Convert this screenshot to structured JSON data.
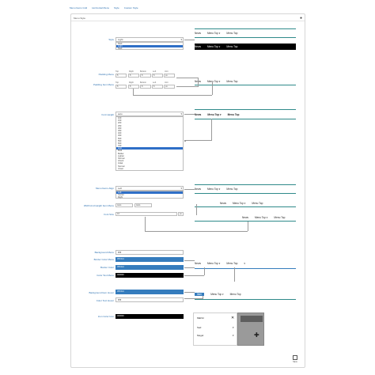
{
  "tabs": [
    "Menu Items Grid",
    "Horizontal Menu",
    "Style",
    "Custom Style"
  ],
  "panel": {
    "title": "Menu Style"
  },
  "fields": {
    "style": {
      "label": "Style",
      "value": "Light",
      "options": [
        "Dark",
        "Light",
        "Dark"
      ]
    },
    "padding_menu": {
      "label": "Padding Menu",
      "caps": [
        "Top",
        "Right",
        "Bottom",
        "Left",
        "Unit"
      ],
      "values": [
        "5",
        "5",
        "5",
        "5",
        "px"
      ]
    },
    "padding_item": {
      "label": "Padding Item Menu",
      "caps": [
        "Top",
        "Right",
        "Bottom",
        "Left",
        "Unit"
      ],
      "values": [
        "5",
        "5",
        "5",
        "5",
        "px"
      ]
    },
    "font_height": {
      "label": "Font Height",
      "value": "auto",
      "options": [
        "100",
        "150",
        "200",
        "250",
        "300",
        "350",
        "400",
        "450",
        "500",
        "550",
        "600",
        "700",
        "auto",
        "Bold",
        "Bolder",
        "Lighter",
        "Normal",
        "Inherit",
        "Initial",
        "Normal",
        "Unset"
      ],
      "highlight": 12
    },
    "align": {
      "label": "Menu Items Align",
      "value": "Left",
      "options": [
        "Left",
        "Center",
        "Right"
      ]
    },
    "width": {
      "label": "Width And Height Item Menu",
      "v1": "Auto",
      "v2": "Auto"
    },
    "font_size": {
      "label": "Font Size",
      "value": "16",
      "unit": "px"
    },
    "bg_menu": {
      "label": "Background Menu",
      "value": "ffffff"
    },
    "border_menu": {
      "label": "Border Color Menu",
      "value": "357cbd"
    },
    "border_color": {
      "label": "Border Color",
      "value": "357cbd"
    },
    "color_text": {
      "label": "Color Text Menu",
      "value": "000000"
    },
    "bg_hover": {
      "label": "Background Item Hover",
      "value": "357cbd"
    },
    "text_hover": {
      "label": "Color Text Hover",
      "value": "ffffff"
    },
    "icon_color": {
      "label": "Icon Color Icon",
      "value": "000000"
    }
  },
  "colors": {
    "blue": "#357cbd",
    "white": "#ffffff",
    "black": "#000000"
  },
  "previews": {
    "style": {
      "light": [
        "News",
        "Menu Top ▾",
        "Menu Top"
      ],
      "dark": [
        "News",
        "Menu Top ▾",
        "Menu Top"
      ]
    },
    "padding": [
      "News",
      "Menu Top ▾",
      "Menu Top"
    ],
    "font": [
      "News",
      "Menu Top ▾",
      "Menu Top"
    ],
    "align_left": [
      "News",
      "Menu Top ▾",
      "Menu Top"
    ],
    "align_center": [
      "News",
      "Menu Top ▾",
      "Menu Top"
    ],
    "align_right": [
      "News",
      "Menu Top ▾",
      "Menu Top"
    ],
    "colors": [
      "News",
      "Menu Top ▾",
      "Menu Top"
    ],
    "hover": [
      "Item",
      "Menu Top ▾",
      "Menu Top"
    ]
  },
  "mobile": {
    "items": [
      "MENU",
      "Sad",
      "Mega!"
    ]
  },
  "save": {
    "label": "Save"
  }
}
